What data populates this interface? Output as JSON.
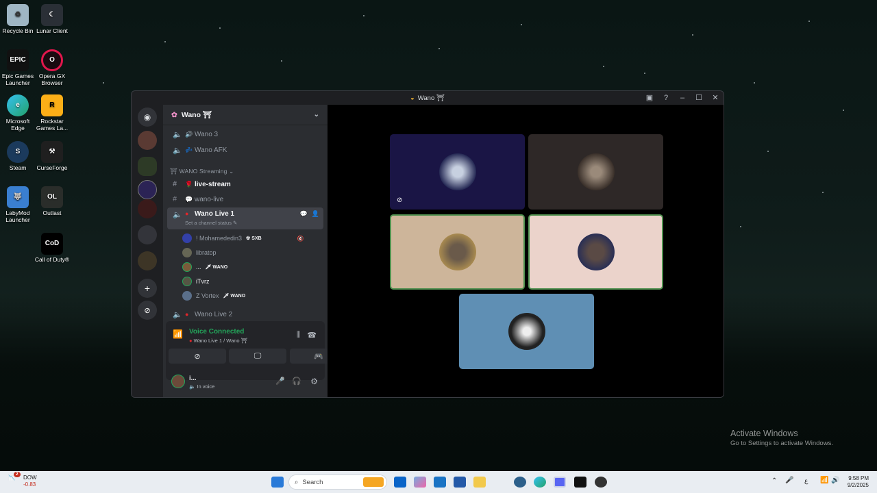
{
  "desktop": {
    "icons": [
      {
        "label": "Recycle Bin"
      },
      {
        "label": "Lunar Client"
      },
      {
        "label": "Epic Games Launcher"
      },
      {
        "label": "Opera GX Browser"
      },
      {
        "label": "Microsoft Edge"
      },
      {
        "label": "Rockstar Games La..."
      },
      {
        "label": "Steam"
      },
      {
        "label": "CurseForge"
      },
      {
        "label": "LabyMod Launcher"
      },
      {
        "label": "Outlast"
      },
      {
        "label": "Call of Duty®"
      }
    ],
    "activate_title": "Activate Windows",
    "activate_sub": "Go to Settings to activate Windows."
  },
  "window": {
    "title": "Wano ⛩"
  },
  "server": {
    "name": "Wano ⛩"
  },
  "channels": [
    {
      "name": "Wano 3"
    },
    {
      "name": "Wano AFK"
    },
    {
      "name": "WANO Streaming"
    },
    {
      "name": "live-stream"
    },
    {
      "name": "wano-live"
    },
    {
      "name": "Wano Live 1",
      "status": "Set a channel status"
    },
    {
      "name": "Wano Live 2"
    }
  ],
  "voice_users": [
    {
      "name": "! Mohamededin3",
      "tag": "SXB"
    },
    {
      "name": "libratop",
      "tag": ""
    },
    {
      "name": "...",
      "tag": "WANO"
    },
    {
      "name": "iTvrz",
      "tag": ""
    },
    {
      "name": "Z Vortex",
      "tag": "WANO"
    }
  ],
  "voice_panel": {
    "status": "Voice Connected",
    "location": "Wano Live 1 / Wano ⛩"
  },
  "user_panel": {
    "name": "i...",
    "status": "In voice"
  },
  "taskbar": {
    "search_placeholder": "Search",
    "stock_name": "DOW",
    "stock_change": "-0.83",
    "stock_badge": "2",
    "time": "9:58 PM",
    "date": "9/2/2025",
    "lang": "ع"
  },
  "colors": {
    "voice_green": "#23a55a",
    "bg_sidebar": "#2b2d31",
    "bg_rail": "#1e1f22",
    "tile_1": "#1a1545",
    "tile_2": "#2e2827",
    "tile_3": "#cdb59a",
    "tile_4": "#ebd3cb",
    "tile_5": "#5f8fb4"
  }
}
